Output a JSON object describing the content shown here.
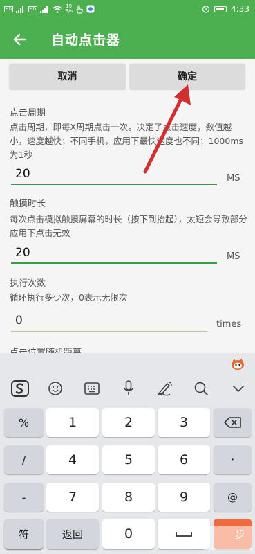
{
  "status_bar": {
    "left_tags": [
      "HD",
      "HD"
    ],
    "net_speed_value": "19",
    "net_speed_unit": "B/s",
    "time": "4:33"
  },
  "app_bar": {
    "title": "自动点击器",
    "color": "#4caf50"
  },
  "buttons": {
    "cancel": "取消",
    "confirm": "确定"
  },
  "sections": [
    {
      "title": "点击周期",
      "desc": "点击周期，即每X周期点击一次。决定了点击速度，数值越小，速度越快；不同手机，应用下最快速度也不同；1000ms为1秒",
      "value": "20",
      "unit": "MS"
    },
    {
      "title": "触摸时长",
      "desc": "每次点击模拟触摸屏幕的时长（按下到抬起），太短会导致部分应用下点击无效",
      "value": "20",
      "unit": "MS"
    },
    {
      "title": "执行次数",
      "desc": "循环执行多少次，0表示无限次",
      "value": "0",
      "unit": "times"
    },
    {
      "title": "点击位置随机距离"
    }
  ],
  "keyboard": {
    "side_keys": [
      "%",
      "/",
      "-",
      "+"
    ],
    "digits": [
      "1",
      "2",
      "3",
      "4",
      "5",
      "6",
      "7",
      "8",
      "9"
    ],
    "right_keys": [
      "·",
      "@"
    ],
    "bottom": {
      "symbols": "符",
      "back": "返回",
      "zero": "0",
      "enter_partial": "步"
    },
    "accent_color": "#f26a3c"
  },
  "annotation_color": "#d32f2f"
}
